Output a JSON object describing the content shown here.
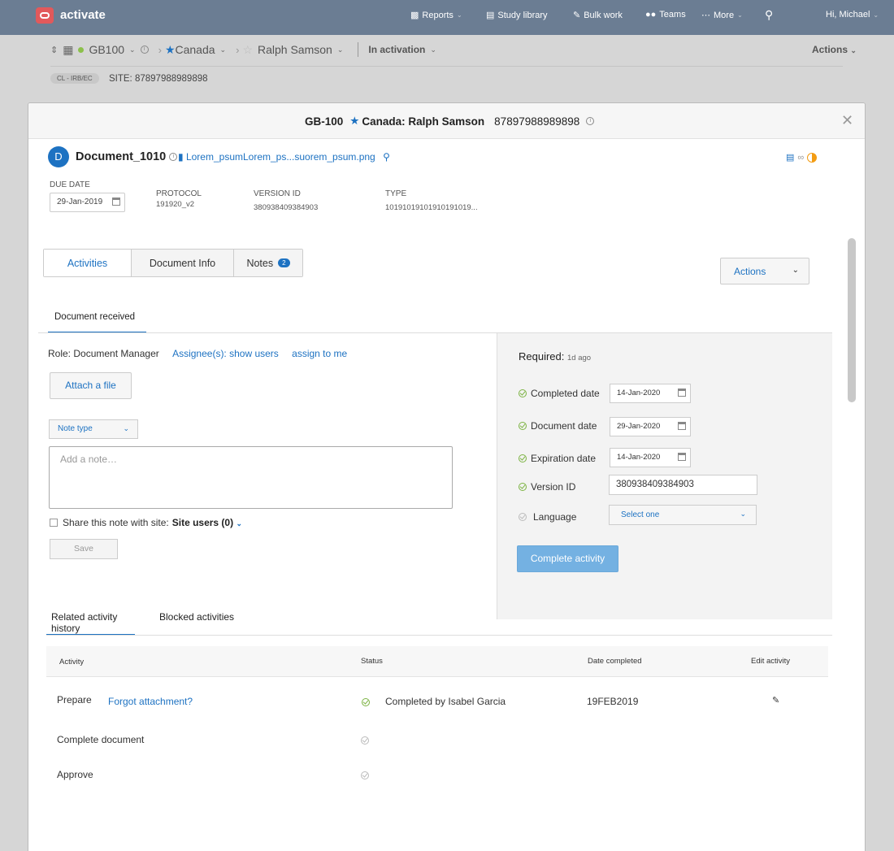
{
  "app": {
    "brand": "activate"
  },
  "topnav": {
    "items": [
      {
        "label": "Reports",
        "icon": "bar-chart-icon"
      },
      {
        "label": "Study library",
        "icon": "library-icon"
      },
      {
        "label": "Bulk work",
        "icon": "pencil-icon"
      },
      {
        "label": "Teams",
        "icon": "users-icon"
      },
      {
        "label": "More",
        "icon": "more-icon"
      }
    ],
    "greeting": "Hi, Michael"
  },
  "breadcrumb": {
    "study": "GB100",
    "country": "Canada",
    "site": "Ralph Samson",
    "status": "In activation",
    "actions": "Actions"
  },
  "site_bar": {
    "chip": "CL - IRB/EC",
    "site_label": "SITE:",
    "site_id": "87897988989898"
  },
  "modal": {
    "title_study": "GB-100",
    "title_site": "Canada: Ralph Samson",
    "title_site_id": "87897988989898",
    "document": {
      "avatar": "D",
      "name": "Document_1010",
      "file": "Lorem_psumLorem_ps...suorem_psum.png"
    },
    "meta": {
      "due_label": "DUE DATE",
      "due_value": "29-Jan-2019",
      "protocol_label": "PROTOCOL",
      "protocol_value": "191920_v2",
      "version_label": "VERSION ID",
      "version_value": "380938409384903",
      "type_label": "TYPE",
      "type_value": "10191019101910191019..."
    },
    "tabs": [
      {
        "label": "Activities"
      },
      {
        "label": "Document Info"
      },
      {
        "label": "Notes",
        "badge": "2"
      }
    ],
    "actions_label": "Actions",
    "subtab": "Document received",
    "left": {
      "role": "Role: Document Manager",
      "assignees": "Assignee(s): show users",
      "assign_me": "assign to me",
      "attach": "Attach a file",
      "note_type": "Note type",
      "note_placeholder": "Add a note…",
      "share_text": "Share this note with site:",
      "share_users": "Site users (0)",
      "save": "Save"
    },
    "right": {
      "required": "Required:",
      "required_ago": "1d ago",
      "completed_label": "Completed date",
      "completed_value": "14-Jan-2020",
      "document_label": "Document date",
      "document_value": "29-Jan-2020",
      "expiration_label": "Expiration date",
      "expiration_value": "14-Jan-2020",
      "version_label": "Version ID",
      "version_value": "380938409384903",
      "language_label": "Language",
      "language_value": "Select one",
      "complete_btn": "Complete activity"
    },
    "history_tabs": [
      "Related activity history",
      "Blocked activities"
    ],
    "table": {
      "headers": [
        "Activity",
        "Status",
        "Date completed",
        "Edit activity"
      ],
      "rows": [
        {
          "activity": "Prepare",
          "link": "Forgot attachment?",
          "status": "Completed by Isabel Garcia",
          "date": "19FEB2019"
        },
        {
          "activity": "Complete document",
          "link": "",
          "status": "",
          "date": ""
        },
        {
          "activity": "Approve",
          "link": "",
          "status": "",
          "date": ""
        }
      ]
    }
  },
  "colors": {
    "nav": "#6b7d93",
    "accent": "#1d72c2",
    "ok": "#7cb342",
    "primary_btn": "#74b1e2"
  }
}
